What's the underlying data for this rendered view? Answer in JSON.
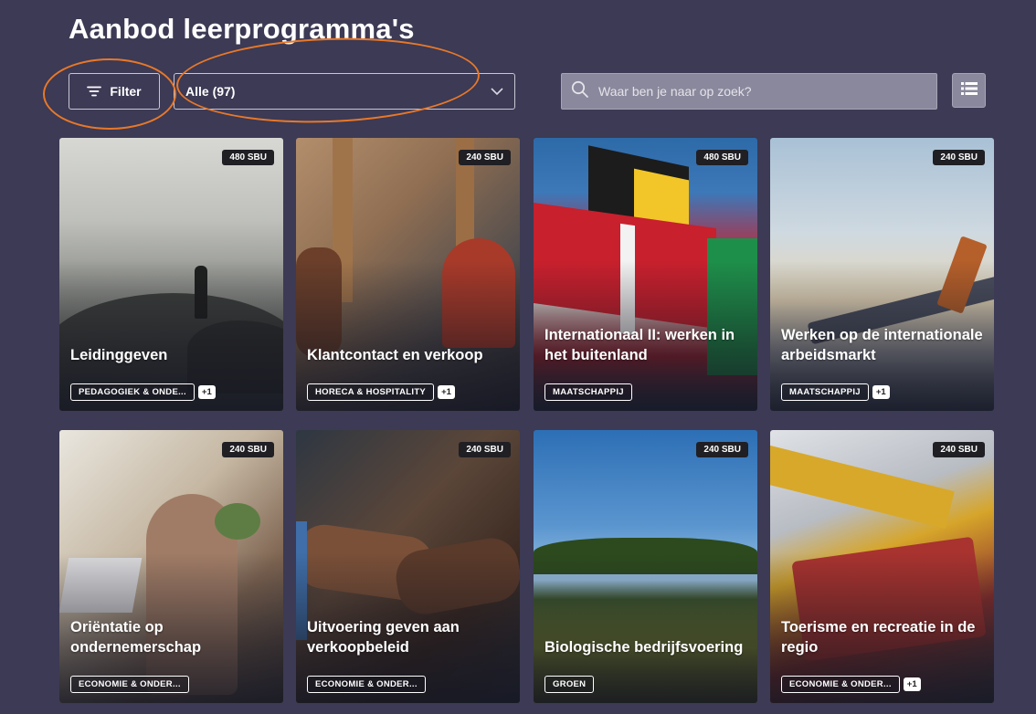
{
  "page": {
    "title": "Aanbod leerprogramma's"
  },
  "toolbar": {
    "filter_label": "Filter",
    "select_value": "Alle (97)",
    "search_placeholder": "Waar ben je naar op zoek?"
  },
  "colors": {
    "background": "#3c3a54",
    "annotation": "#e8782a",
    "badge": "#1f1f24"
  },
  "cards": [
    {
      "title": "Leidinggeven",
      "sbu": "480 SBU",
      "tag": "PEDAGOGIEK & ONDE...",
      "extra": "+1"
    },
    {
      "title": "Klantcontact en verkoop",
      "sbu": "240 SBU",
      "tag": "HORECA & HOSPITALITY",
      "extra": "+1"
    },
    {
      "title": "Internationaal II: werken in het buitenland",
      "sbu": "480 SBU",
      "tag": "MAATSCHAPPIJ",
      "extra": ""
    },
    {
      "title": "Werken op de internationale arbeidsmarkt",
      "sbu": "240 SBU",
      "tag": "MAATSCHAPPIJ",
      "extra": "+1"
    },
    {
      "title": "Oriëntatie op ondernemerschap",
      "sbu": "240 SBU",
      "tag": "ECONOMIE & ONDER...",
      "extra": ""
    },
    {
      "title": "Uitvoering geven aan verkoopbeleid",
      "sbu": "240 SBU",
      "tag": "ECONOMIE & ONDER...",
      "extra": ""
    },
    {
      "title": "Biologische bedrijfsvoering",
      "sbu": "240 SBU",
      "tag": "GROEN",
      "extra": ""
    },
    {
      "title": "Toerisme en recreatie in de regio",
      "sbu": "240 SBU",
      "tag": "ECONOMIE & ONDER...",
      "extra": "+1"
    }
  ],
  "icons": {
    "filter": "filter-lines-icon",
    "dropdown": "chevron-down-icon",
    "search": "search-icon",
    "view": "list-view-icon"
  }
}
